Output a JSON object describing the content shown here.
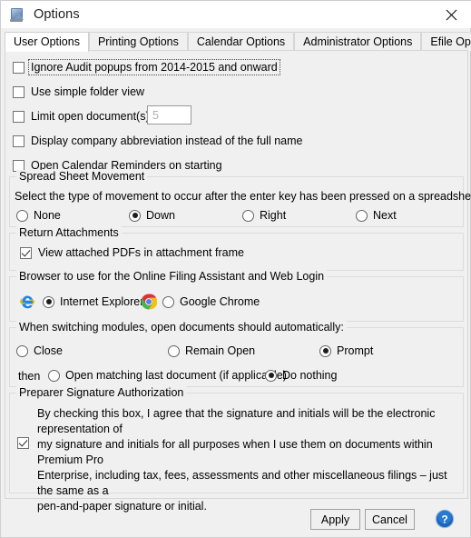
{
  "window": {
    "title": "Options",
    "icon": "app-icon",
    "close_label": "✕"
  },
  "tabs": [
    {
      "label": "User Options",
      "selected": true
    },
    {
      "label": "Printing Options",
      "selected": false
    },
    {
      "label": "Calendar Options",
      "selected": false
    },
    {
      "label": "Administrator Options",
      "selected": false
    },
    {
      "label": "Efile Options",
      "selected": false
    }
  ],
  "user_options": {
    "checkboxes": [
      {
        "label": "Ignore Audit popups from 2014-2015 and onward",
        "checked": false,
        "focused": true
      },
      {
        "label": "Use simple folder view",
        "checked": false,
        "focused": false
      },
      {
        "label": "Limit open document(s) to",
        "checked": false,
        "focused": false
      },
      {
        "label": "Display company abbreviation instead of the full name",
        "checked": false,
        "focused": false
      },
      {
        "label": "Open Calendar Reminders on starting",
        "checked": false,
        "focused": false
      }
    ],
    "limit_value": "5",
    "spreadsheet": {
      "legend": "Spread Sheet Movement",
      "description": "Select the type of movement to occur after the enter key has been pressed on a spreadsheet.",
      "options": [
        {
          "label": "None",
          "selected": false
        },
        {
          "label": "Down",
          "selected": true
        },
        {
          "label": "Right",
          "selected": false
        },
        {
          "label": "Next",
          "selected": false
        }
      ]
    },
    "return_attachments": {
      "legend": "Return Attachments",
      "checkbox": {
        "label": "View attached PDFs in attachment frame",
        "checked": true
      }
    },
    "browser": {
      "legend": "Browser to use for the Online Filing Assistant and Web Login",
      "options": [
        {
          "label": "Internet Explorer",
          "selected": true,
          "icon": "internet-explorer-icon"
        },
        {
          "label": "Google Chrome",
          "selected": false,
          "icon": "google-chrome-icon"
        }
      ]
    },
    "switching": {
      "legend": "When switching modules, open documents should automatically:",
      "options": [
        {
          "label": "Close",
          "selected": false
        },
        {
          "label": "Remain Open",
          "selected": false
        },
        {
          "label": "Prompt",
          "selected": true
        }
      ],
      "then_label": "then",
      "then_options": [
        {
          "label": "Open matching last document (if applicable)",
          "selected": false
        },
        {
          "label": "Do nothing",
          "selected": true
        }
      ]
    },
    "signature": {
      "legend": "Preparer Signature Authorization",
      "checked": true,
      "lines": [
        "By checking this box, I agree that the signature and initials will be the electronic representation of",
        "my signature and initials for all purposes when I use them on documents within Premium Pro",
        "Enterprise, including tax, fees, assessments and other miscellaneous filings – just the same as a",
        "pen-and-paper signature or initial."
      ]
    }
  },
  "footer": {
    "apply_label": "Apply",
    "cancel_label": "Cancel",
    "help_label": "?"
  },
  "colors": {
    "dialog_bg": "#f0f0f0",
    "panel_bg": "#f0f0f0",
    "titlebar_bg": "#ffffff",
    "group_border": "#dcdcdc",
    "help_blue": "#1565c0"
  }
}
